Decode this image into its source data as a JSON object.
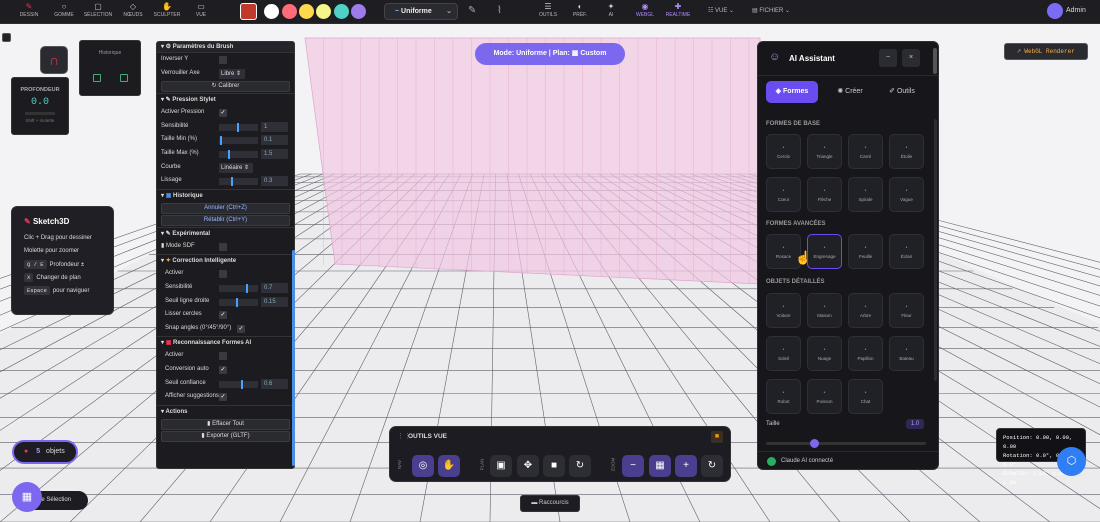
{
  "topbar": {
    "tools": [
      {
        "icon": "pencil-icon",
        "label": "DESSIN"
      },
      {
        "icon": "eraser-icon",
        "label": "GOMME"
      },
      {
        "icon": "select-icon",
        "label": "SÉLECTION"
      },
      {
        "icon": "node-icon",
        "label": "NŒUDS"
      },
      {
        "icon": "sculpt-icon",
        "label": "SCULPTER"
      },
      {
        "icon": "view-icon",
        "label": "VUE"
      }
    ],
    "swatches": [
      "#c0392b",
      "#ffffff",
      "#ff6b7a",
      "#ffd84d",
      "#f5f58a",
      "#4fd1c5",
      "#9f7aea"
    ],
    "mode_select": "Uniforme",
    "right_tools": [
      {
        "icon": "tools-icon",
        "label": "OUTILS"
      },
      {
        "icon": "prefs-icon",
        "label": "PRÉF."
      },
      {
        "icon": "ai-icon",
        "label": "AI"
      },
      {
        "icon": "webgl-icon",
        "label": "WEBGL"
      },
      {
        "icon": "realtime-icon",
        "label": "REALTIME"
      }
    ],
    "vue": "VUE",
    "fichier": "FICHIER",
    "user": "Admin"
  },
  "history_mini": {
    "title": "Historique"
  },
  "depth": {
    "title": "PROFONDEUR",
    "value": "0.0",
    "hint": "Shift + molette"
  },
  "brush": {
    "title": "Paramètres du Brush",
    "rows_top": [
      {
        "label": "Inverser Y",
        "type": "cb"
      },
      {
        "label": "Verrouiller Axe",
        "type": "dd",
        "value": "Libre"
      }
    ],
    "calibrer": "Calibrer",
    "pression": {
      "title": "Pression Stylet",
      "activer": "Activer Pression",
      "sensibilite": "Sensibilité",
      "sens_val": "1",
      "tmin": "Taille Min (%)",
      "tmin_val": "0.1",
      "tmax": "Taille Max (%)",
      "tmax_val": "1.5",
      "courbe": "Courbe",
      "courbe_val": "Linéaire",
      "lissage": "Lissage",
      "lissage_val": "0.3"
    },
    "historique": {
      "title": "Historique",
      "annuler": "Annuler (Ctrl+Z)",
      "retablir": "Rétablir (Ctrl+Y)"
    },
    "experimental": {
      "title": "Expérimental",
      "sdf": "Mode SDF"
    },
    "correction": {
      "title": "Correction Intelligente",
      "activer": "Activer",
      "sens": "Sensibilité",
      "sens_val": "0.7",
      "seuil": "Seuil ligne droite",
      "seuil_val": "0.15",
      "lisser": "Lisser cercles",
      "snap": "Snap angles (0°/45°/90°)"
    },
    "reco": {
      "title": "Reconnaissance Formes AI",
      "activer": "Activer",
      "conv": "Conversion auto",
      "seuil": "Seuil confiance",
      "seuil_val": "0.6",
      "sugg": "Afficher suggestions"
    },
    "actions": {
      "title": "Actions",
      "effacer": "Effacer Tout",
      "exporter": "Exporter (GLTF)"
    }
  },
  "help": {
    "title": "Sketch3D",
    "lines": [
      {
        "key": "",
        "text": "Clic + Drag pour dessiner"
      },
      {
        "key": "",
        "text": "Molette pour zoomer"
      },
      {
        "key": "Q / E",
        "text": "Profondeur ±"
      },
      {
        "key": "X",
        "text": "Changer de plan"
      },
      {
        "key": "Espace",
        "text": "pour naviguer"
      }
    ]
  },
  "mode_pill": {
    "text": "Mode: Uniforme | Plan:",
    "plan": "Custom"
  },
  "objects_badge": {
    "count": "5",
    "label": "objets"
  },
  "selection_label": "de Sélection",
  "view_tools": {
    "title": "OUTILS VUE",
    "groups": [
      "NAV",
      "PLAN",
      "ZOOM"
    ]
  },
  "raccourcis": "Raccourcis",
  "webgl_renderer": "WebGL Renderer",
  "transform": {
    "position_label": "Position:",
    "position": "0.00, 0.00, 0.00",
    "rotation_label": "Rotation:",
    "rotation": "0.0°, 0.0°, 0.0°",
    "echelle_label": "Échelle:",
    "echelle": "1.00, 1.00, 1.00"
  },
  "ai": {
    "title": "AI Assistant",
    "tabs": [
      {
        "icon": "layers-icon",
        "label": "Formes"
      },
      {
        "icon": "sparkle-icon",
        "label": "Créer"
      },
      {
        "icon": "wrench-icon",
        "label": "Outils"
      }
    ],
    "base_title": "FORMES DE BASE",
    "base": [
      "Cercle",
      "Triangle",
      "Carré",
      "Étoile",
      "Cœur",
      "Flèche",
      "Spirale",
      "Vague"
    ],
    "adv_title": "FORMES AVANCÉES",
    "adv": [
      "Rosace",
      "Engrenage",
      "Feuille",
      "Éclair"
    ],
    "det_title": "OBJETS DÉTAILLÉS",
    "det": [
      "Voiture",
      "Maison",
      "Arbre",
      "Fleur",
      "Soleil",
      "Nuage",
      "Papillon",
      "Bateau",
      "Robot",
      "Poisson",
      "Chat"
    ],
    "taille_label": "Taille",
    "taille_value": "1.0",
    "status": "Claude AI connecté",
    "status_color": "#27ae60",
    "accent": "#6a4cf0"
  }
}
